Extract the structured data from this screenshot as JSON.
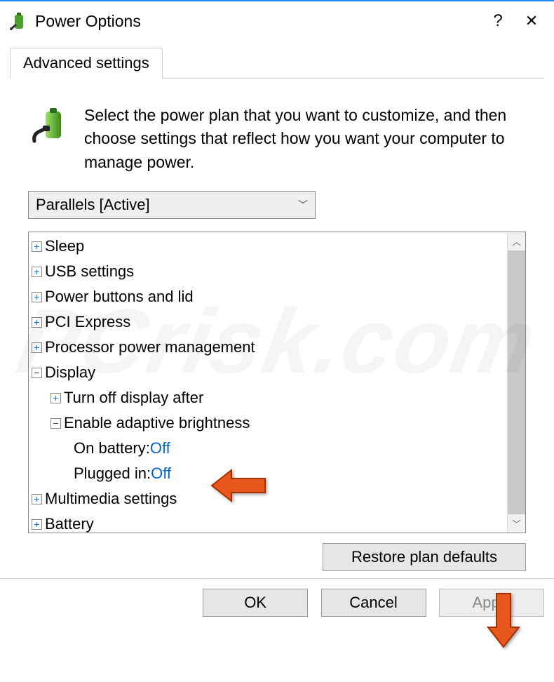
{
  "titlebar": {
    "title": "Power Options",
    "help": "?",
    "close": "✕"
  },
  "tabs": {
    "advanced": "Advanced settings"
  },
  "instruction": "Select the power plan that you want to customize, and then choose settings that reflect how you want your computer to manage power.",
  "plan": {
    "selected": "Parallels [Active]"
  },
  "tree": {
    "sleep": "Sleep",
    "usb": "USB settings",
    "power_buttons": "Power buttons and lid",
    "pci": "PCI Express",
    "processor": "Processor power management",
    "display": "Display",
    "turn_off_display": "Turn off display after",
    "adaptive": "Enable adaptive brightness",
    "on_battery_label": "On battery: ",
    "on_battery_value": "Off",
    "plugged_in_label": "Plugged in: ",
    "plugged_in_value": "Off",
    "multimedia": "Multimedia settings",
    "battery": "Battery"
  },
  "buttons": {
    "restore": "Restore plan defaults",
    "ok": "OK",
    "cancel": "Cancel",
    "apply": "Apply"
  },
  "watermark": "PCrisk.com"
}
